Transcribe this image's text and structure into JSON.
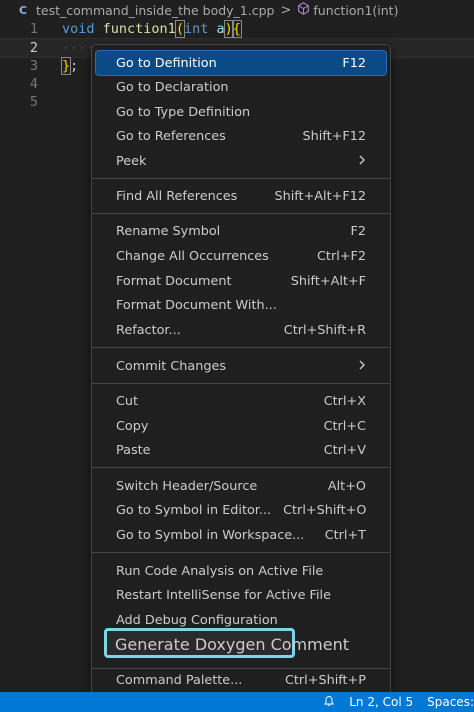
{
  "breadcrumb": {
    "file_icon": "C",
    "file": "test_command_inside_the body_1.cpp",
    "separator": ">",
    "symbol_icon": "symbol-method-icon",
    "symbol": "function1(int)"
  },
  "editor": {
    "lines": [
      {
        "num": "1",
        "kw": "void",
        "fn": "function1",
        "open": "(",
        "type": "int",
        "param": "a",
        "close": ")",
        "brace": "{"
      },
      {
        "num": "2",
        "dots": "····"
      },
      {
        "num": "3",
        "brace": "}",
        "semi": ";"
      },
      {
        "num": "4"
      },
      {
        "num": "5"
      }
    ]
  },
  "menu": {
    "items": [
      {
        "label": "Go to Definition",
        "kb": "F12"
      },
      {
        "label": "Go to Declaration",
        "kb": ""
      },
      {
        "label": "Go to Type Definition",
        "kb": ""
      },
      {
        "label": "Go to References",
        "kb": "Shift+F12"
      },
      {
        "label": "Peek",
        "kb": ">"
      },
      {
        "label": "Find All References",
        "kb": "Shift+Alt+F12"
      },
      {
        "label": "Rename Symbol",
        "kb": "F2"
      },
      {
        "label": "Change All Occurrences",
        "kb": "Ctrl+F2"
      },
      {
        "label": "Format Document",
        "kb": "Shift+Alt+F"
      },
      {
        "label": "Format Document With...",
        "kb": ""
      },
      {
        "label": "Refactor...",
        "kb": "Ctrl+Shift+R"
      },
      {
        "label": "Commit Changes",
        "kb": ">"
      },
      {
        "label": "Cut",
        "kb": "Ctrl+X"
      },
      {
        "label": "Copy",
        "kb": "Ctrl+C"
      },
      {
        "label": "Paste",
        "kb": "Ctrl+V"
      },
      {
        "label": "Switch Header/Source",
        "kb": "Alt+O"
      },
      {
        "label": "Go to Symbol in Editor...",
        "kb": "Ctrl+Shift+O"
      },
      {
        "label": "Go to Symbol in Workspace...",
        "kb": "Ctrl+T"
      },
      {
        "label": "Run Code Analysis on Active File",
        "kb": ""
      },
      {
        "label": "Restart IntelliSense for Active File",
        "kb": ""
      },
      {
        "label": "Add Debug Configuration",
        "kb": ""
      },
      {
        "label": "Generate Doxygen Comment",
        "kb": ""
      },
      {
        "label": "Command Palette...",
        "kb": "Ctrl+Shift+P"
      }
    ]
  },
  "status": {
    "icon": "bell-icon",
    "position": "Ln 2, Col 5",
    "spaces": "Spaces:"
  },
  "colors": {
    "accent": "#0078d4",
    "selected": "#0a4a87",
    "highlight_box": "#7dd3e8"
  }
}
